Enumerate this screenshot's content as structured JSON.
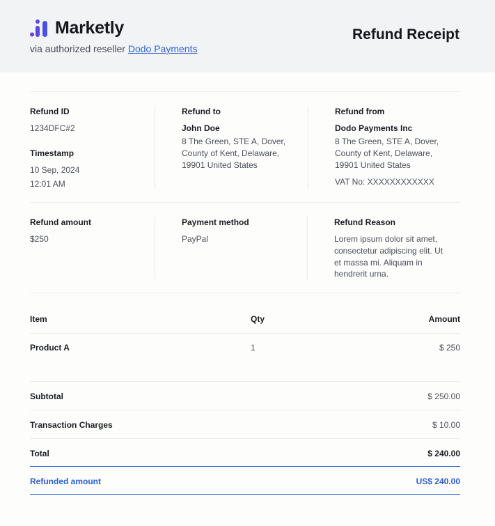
{
  "header": {
    "brand_name": "Marketly",
    "via_prefix": "via authorized reseller",
    "reseller_link": "Dodo Payments",
    "title": "Refund Receipt",
    "logo_color": "#5a3de0"
  },
  "info": {
    "refund_id_label": "Refund ID",
    "refund_id": "1234DFC#2",
    "timestamp_label": "Timestamp",
    "timestamp_date": "10 Sep, 2024",
    "timestamp_time": "12:01 AM",
    "refund_to_label": "Refund to",
    "refund_to_name": "John Doe",
    "refund_to_address": [
      "8 The Green, STE A, Dover,",
      "County of Kent, Delaware,",
      "19901 United States"
    ],
    "refund_from_label": "Refund from",
    "refund_from_name": "Dodo Payments Inc",
    "refund_from_address": [
      "8 The Green, STE A, Dover,",
      "County of Kent, Delaware,",
      "19901 United States"
    ],
    "vat": "VAT No: XXXXXXXXXXXX"
  },
  "details": {
    "refund_amount_label": "Refund amount",
    "refund_amount": "$250",
    "payment_method_label": "Payment method",
    "payment_method": "PayPal",
    "reason_label": "Refund Reason",
    "reason_lines": [
      "Lorem ipsum dolor sit amet,",
      "consectetur adipiscing elit. Ut",
      "et massa mi. Aliquam in",
      "hendrerit urna."
    ]
  },
  "table": {
    "headers": {
      "item": "Item",
      "qty": "Qty",
      "amount": "Amount"
    },
    "rows": [
      {
        "item": "Product A",
        "qty": "1",
        "amount": "$ 250"
      }
    ]
  },
  "summary": {
    "subtotal_label": "Subtotal",
    "subtotal": "$ 250.00",
    "charges_label": "Transaction Charges",
    "charges": "$ 10.00",
    "total_label": "Total",
    "total": "$ 240.00",
    "refunded_label": "Refunded amount",
    "refunded": "US$ 240.00"
  },
  "colors": {
    "accent": "#2a5fcf",
    "header_bg": "#f2f3f5"
  }
}
